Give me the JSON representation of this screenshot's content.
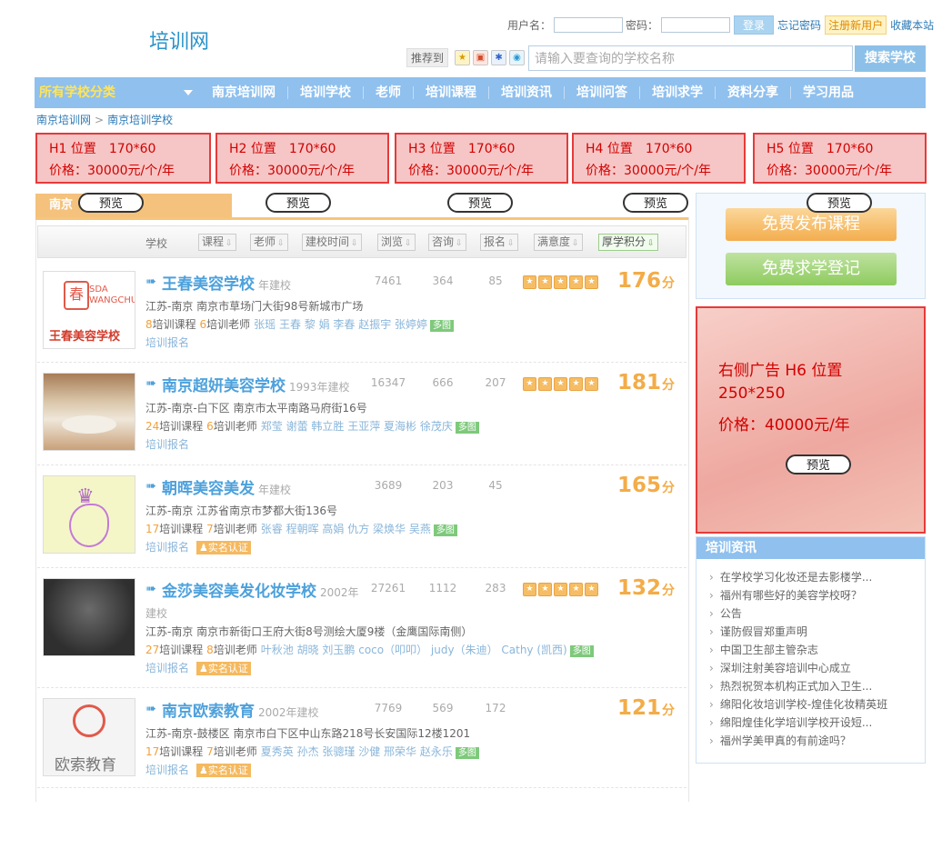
{
  "header": {
    "logo": "培训网",
    "username_label": "用户名：",
    "password_label": "密码：",
    "login_button": "登录",
    "forgot_link": "忘记密码",
    "register_button": "注册新用户",
    "bookmark_link": "收藏本站",
    "recommend_label": "推荐到",
    "search_placeholder": "请输入要查询的学校名称",
    "search_button": "搜索学校"
  },
  "nav": {
    "all_label": "所有学校分类",
    "items": [
      "南京培训网",
      "培训学校",
      "老师",
      "培训课程",
      "培训资讯",
      "培训问答",
      "培训求学",
      "资料分享",
      "学习用品"
    ]
  },
  "breadcrumb": [
    "南京培训网",
    "南京培训学校"
  ],
  "ads": [
    {
      "pos": "H1 位置　170*60",
      "price": "价格：30000元/个/年"
    },
    {
      "pos": "H2 位置　170*60",
      "price": "价格：30000元/个/年"
    },
    {
      "pos": "H3 位置　170*60",
      "price": "价格：30000元/个/年"
    },
    {
      "pos": "H4 位置　170*60",
      "price": "价格：30000元/个/年"
    },
    {
      "pos": "H5 位置　170*60",
      "price": "价格：30000元/个/年"
    }
  ],
  "preview_label": "预览",
  "tab": {
    "active": "南京"
  },
  "sortbar": {
    "school_label": "学校",
    "buttons": [
      "课程",
      "老师",
      "建校时间",
      "浏览",
      "咨询",
      "报名",
      "满意度",
      "厚学积分"
    ]
  },
  "schools": [
    {
      "name": "王春美容学校",
      "year": "年建校",
      "views": "7461",
      "consult": "364",
      "signup": "85",
      "rated": true,
      "score": "176",
      "unit": "分",
      "address": "江苏-南京 南京市草场门大街98号新城市广场",
      "courses": "8",
      "course_label": "培训课程",
      "teachers": "6",
      "teacher_label": "培训老师",
      "teacher_names": "张瑶 王春 黎 娟 李春 赵振宇 张婷婷",
      "tag": "多图",
      "apply": "培训报名",
      "verified": false,
      "logo_text": "王春美容学校"
    },
    {
      "name": "南京超妍美容学校",
      "year": "1993年建校",
      "views": "16347",
      "consult": "666",
      "signup": "207",
      "rated": true,
      "score": "181",
      "unit": "分",
      "address": "江苏-南京-白下区 南京市太平南路马府街16号",
      "courses": "24",
      "course_label": "培训课程",
      "teachers": "6",
      "teacher_label": "培训老师",
      "teacher_names": "郑莹 谢蕾 韩立胜 王亚萍 夏海彬 徐茂庆",
      "tag": "多图",
      "apply": "培训报名",
      "verified": false,
      "logo_text": ""
    },
    {
      "name": "朝晖美容美发",
      "year": "年建校",
      "views": "3689",
      "consult": "203",
      "signup": "45",
      "rated": false,
      "score": "165",
      "unit": "分",
      "address": "江苏-南京 江苏省南京市梦都大街136号",
      "courses": "17",
      "course_label": "培训课程",
      "teachers": "7",
      "teacher_label": "培训老师",
      "teacher_names": "张睿 程朝晖 高娟 仇方 梁焕华 吴燕",
      "tag": "多图",
      "apply": "培训报名",
      "verified": true,
      "verify_label": "实名认证",
      "logo_text": ""
    },
    {
      "name": "金莎美容美发化妆学校",
      "year": "2002年",
      "year2": "建校",
      "views": "27261",
      "consult": "1112",
      "signup": "283",
      "rated": true,
      "score": "132",
      "unit": "分",
      "address": "江苏-南京 南京市新街口王府大街8号测绘大厦9楼（金鹰国际南侧）",
      "courses": "27",
      "course_label": "培训课程",
      "teachers": "8",
      "teacher_label": "培训老师",
      "teacher_names": "叶秋池 胡晓 刘玉鹏 coco（叩叩） judy（朱迪） Cathy (凯西)",
      "tag": "多图",
      "apply": "培训报名",
      "verified": true,
      "verify_label": "实名认证",
      "logo_text": ""
    },
    {
      "name": "南京欧索教育",
      "year": "2002年建校",
      "views": "7769",
      "consult": "569",
      "signup": "172",
      "rated": false,
      "score": "121",
      "unit": "分",
      "address": "江苏-南京-鼓楼区 南京市白下区中山东路218号长安国际12楼1201",
      "courses": "17",
      "course_label": "培训课程",
      "teachers": "7",
      "teacher_label": "培训老师",
      "teacher_names": "夏秀英 孙杰 张骢瑾 沙健 邢荣华 赵永乐",
      "tag": "多图",
      "apply": "培训报名",
      "verified": true,
      "verify_label": "实名认证",
      "logo_text": "欧索教育"
    }
  ],
  "sidebar": {
    "publish_course": "免费发布课程",
    "study_register": "免费求学登记",
    "ad_line1": "右侧广告 H6 位置",
    "ad_line2": "250*250",
    "ad_line3": "价格：40000元/年",
    "news_title": "培训资讯",
    "news": [
      "在学校学习化妆还是去影楼学...",
      "福州有哪些好的美容学校呀？",
      "公告",
      "谨防假冒郑重声明",
      "中国卫生部主管杂志",
      "深圳注射美容培训中心成立",
      "热烈祝贺本机构正式加入卫生...",
      "绵阳化妆培训学校-煌佳化妆精英班",
      "绵阳煌佳化学培训学校开设短...",
      "福州学美甲真的有前途吗？"
    ]
  },
  "colors": {
    "nav_bg": "#8fc0ee",
    "accent_orange": "#f3ac48",
    "ad_red": "#e63a3a",
    "link_blue": "#2c7ab5"
  }
}
